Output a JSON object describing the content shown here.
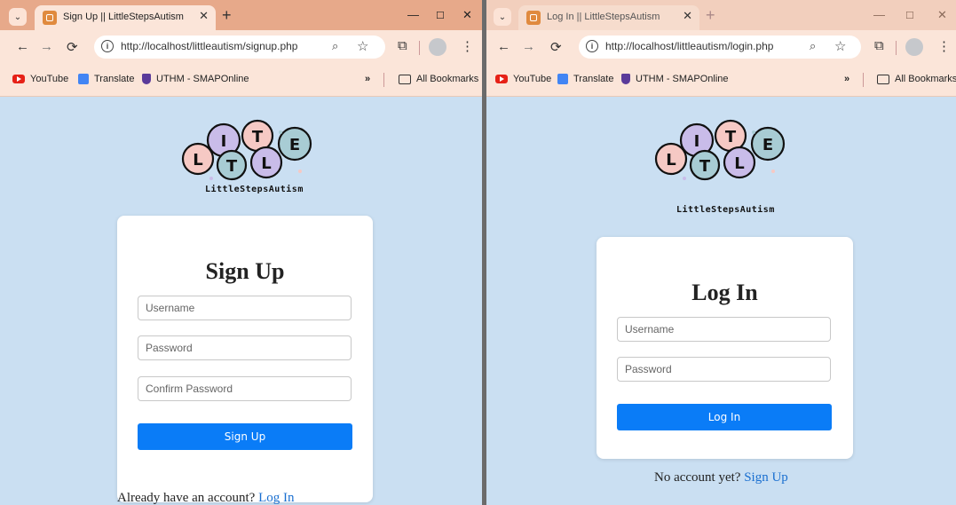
{
  "left_window": {
    "tab_title": "Sign Up || LittleStepsAutism",
    "url_host": "http://localhost",
    "url_path": "/littleautism/signup.php",
    "bookmarks": [
      "YouTube",
      "Translate",
      "UTHM - SMAPOnline"
    ],
    "all_bookmarks": "All Bookmarks",
    "brand": "LittleStepsAutism",
    "heading": "Sign Up",
    "username_placeholder": "Username",
    "password_placeholder": "Password",
    "confirm_placeholder": "Confirm Password",
    "button_label": "Sign Up",
    "footer_text": "Already have an account?",
    "footer_link": "Log In"
  },
  "right_window": {
    "tab_title": "Log In || LittleStepsAutism",
    "url_host": "http://localhost",
    "url_path": "/littleautism/login.php",
    "bookmarks": [
      "YouTube",
      "Translate",
      "UTHM - SMAPOnline"
    ],
    "all_bookmarks": "All Bookmarks",
    "brand": "LittleStepsAutism",
    "heading": "Log In",
    "username_placeholder": "Username",
    "password_placeholder": "Password",
    "button_label": "Log In",
    "footer_text": "No account yet?",
    "footer_link": "Sign Up"
  },
  "logo_letters": [
    "L",
    "I",
    "T",
    "T",
    "L",
    "E"
  ],
  "colors": {
    "page_bg": "#cadff2",
    "tab_strip": "#e7a98a",
    "toolbar": "#fbe5d9",
    "button": "#0a7cf7",
    "link": "#1a6fd0",
    "logo_pink": "#f6c9c4",
    "logo_teal": "#a8ccd4",
    "logo_purple": "#c9bce9"
  }
}
